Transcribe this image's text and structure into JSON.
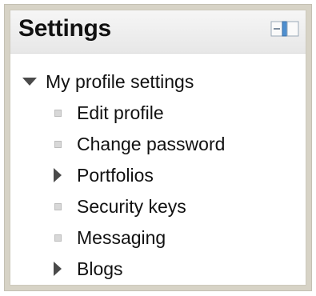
{
  "block": {
    "title": "Settings",
    "dock_icon": "dock-block-icon"
  },
  "tree": {
    "root": {
      "label": "My profile settings",
      "state": "expanded",
      "icon": "triangle-down-icon"
    },
    "items": [
      {
        "label": "Edit profile",
        "type": "leaf",
        "icon": "bullet-icon"
      },
      {
        "label": "Change password",
        "type": "leaf",
        "icon": "bullet-icon"
      },
      {
        "label": "Portfolios",
        "type": "branch-collapsed",
        "icon": "triangle-right-icon"
      },
      {
        "label": "Security keys",
        "type": "leaf",
        "icon": "bullet-icon"
      },
      {
        "label": "Messaging",
        "type": "leaf",
        "icon": "bullet-icon"
      },
      {
        "label": "Blogs",
        "type": "branch-collapsed",
        "icon": "triangle-right-icon"
      }
    ]
  },
  "colors": {
    "frame": "#d7d3c6",
    "header_bg": "#eeeeee",
    "text": "#111111",
    "triangle": "#4a4a4a"
  }
}
